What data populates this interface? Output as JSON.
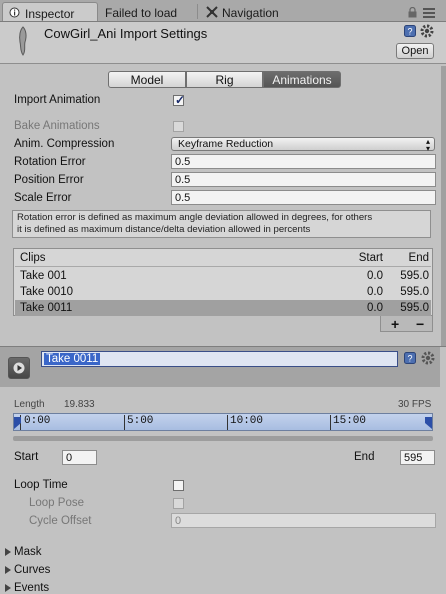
{
  "tabs": [
    {
      "label": "Inspector",
      "active": true
    },
    {
      "label": "Failed to load",
      "active": false
    },
    {
      "label": "Navigation",
      "active": false
    }
  ],
  "header": {
    "title": "CowGirl_Ani Import Settings",
    "open_label": "Open"
  },
  "segments": [
    {
      "label": "Model",
      "selected": false
    },
    {
      "label": "Rig",
      "selected": false
    },
    {
      "label": "Animations",
      "selected": true
    }
  ],
  "import_animation": {
    "label": "Import Animation",
    "checked": true
  },
  "bake_animations": {
    "label": "Bake Animations",
    "checked": false
  },
  "compression": {
    "label": "Anim. Compression",
    "value": "Keyframe Reduction"
  },
  "rotation_error": {
    "label": "Rotation Error",
    "value": "0.5"
  },
  "position_error": {
    "label": "Position Error",
    "value": "0.5"
  },
  "scale_error": {
    "label": "Scale Error",
    "value": "0.5"
  },
  "help_text": {
    "line1": "Rotation error is defined as maximum angle deviation allowed in degrees, for others",
    "line2": "it is defined as maximum distance/delta deviation allowed in percents"
  },
  "clips": {
    "headers": {
      "name": "Clips",
      "start": "Start",
      "end": "End"
    },
    "rows": [
      {
        "name": "Take 001",
        "start": "0.0",
        "end": "595.0",
        "selected": false
      },
      {
        "name": "Take 0010",
        "start": "0.0",
        "end": "595.0",
        "selected": false
      },
      {
        "name": "Take 0011",
        "start": "0.0",
        "end": "595.0",
        "selected": true
      }
    ],
    "add_label": "+",
    "remove_label": "−"
  },
  "clip_name": "Take 0011",
  "timeline": {
    "length_label": "Length",
    "length_value": "19.833",
    "fps": "30 FPS",
    "ticks": [
      "0:00",
      "5:00",
      "10:00",
      "15:00"
    ]
  },
  "start": {
    "label": "Start",
    "value": "0"
  },
  "end": {
    "label": "End",
    "value": "595"
  },
  "loop_time": {
    "label": "Loop Time",
    "checked": false
  },
  "loop_pose": {
    "label": "Loop Pose",
    "checked": false
  },
  "cycle_offset": {
    "label": "Cycle Offset",
    "value": "0"
  },
  "foldouts": {
    "mask": "Mask",
    "curves": "Curves",
    "events": "Events"
  },
  "colors": {
    "selected_segment": "#5f5f5f",
    "clip_name_field": "#3a66c8",
    "timeline_bar": "#b4c6e6"
  }
}
